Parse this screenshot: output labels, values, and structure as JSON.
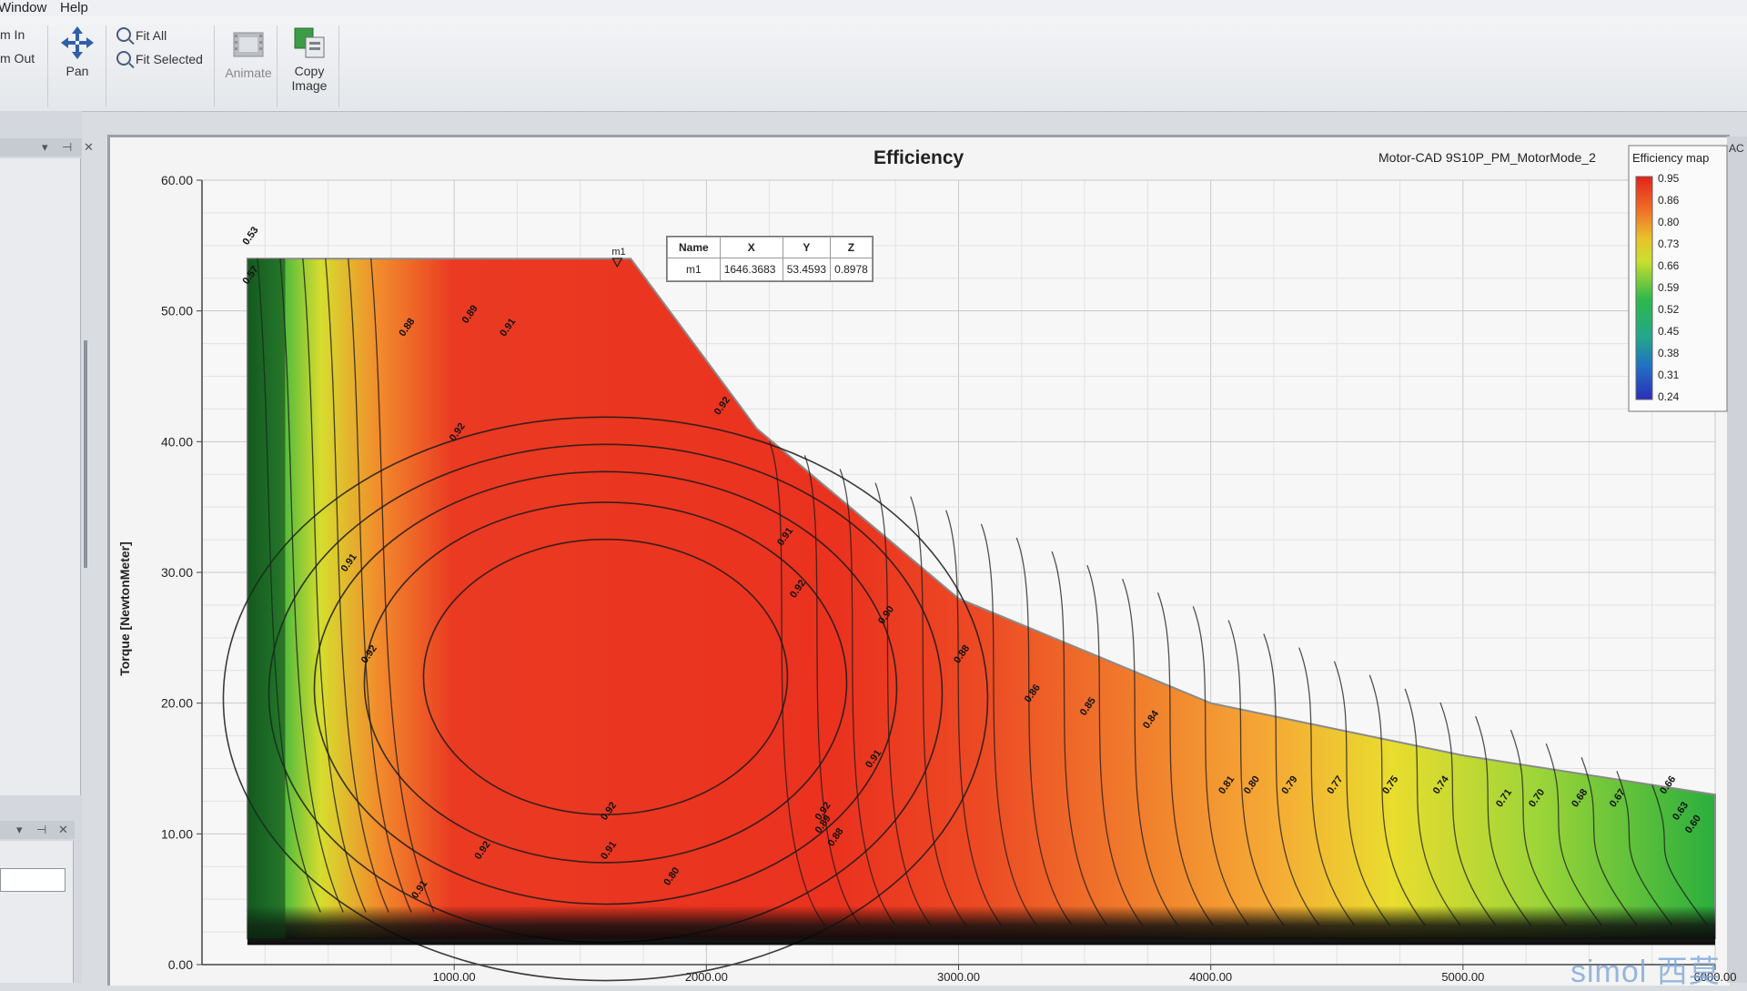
{
  "menu": {
    "window": "Window",
    "help": "Help"
  },
  "toolbar": {
    "zoom_in": "m In",
    "zoom_out": "m Out",
    "pan": "Pan",
    "fit_all": "Fit All",
    "fit_selected": "Fit Selected",
    "animate": "Animate",
    "copy_image": [
      "Copy",
      "Image"
    ]
  },
  "panel_controls": {
    "dropdown": "▾",
    "pin": "⊣",
    "close": "✕"
  },
  "right_tab": "AC",
  "chart": {
    "title": "Efficiency",
    "subtitle": "Motor-CAD 9S10P_PM_MotorMode_2",
    "ylabel": "Torque [NewtonMeter]",
    "watermark": "simol 西莫"
  },
  "marker_table": {
    "headers": [
      "Name",
      "X",
      "Y",
      "Z"
    ],
    "rows": [
      [
        "m1",
        "1646.3683",
        "53.4593",
        "0.8978"
      ]
    ]
  },
  "colors": {
    "red": "#e8321e",
    "orange": "#f0802a",
    "yellow": "#e6e02c",
    "green": "#2fb84a",
    "blue": "#2a3fc8"
  },
  "chart_data": {
    "type": "heatmap",
    "title": "Efficiency",
    "subtitle": "Motor-CAD 9S10P_PM_MotorMode_2",
    "xlabel": "",
    "ylabel": "Torque [NewtonMeter]",
    "xlim": [
      0,
      6000
    ],
    "ylim": [
      0,
      60
    ],
    "x_ticks": [
      "1000.00",
      "2000.00",
      "3000.00",
      "4000.00",
      "5000.00",
      "6000.00"
    ],
    "y_ticks": [
      "0.00",
      "10.00",
      "20.00",
      "30.00",
      "40.00",
      "50.00",
      "60.00"
    ],
    "legend": {
      "title": "Efficiency map",
      "position": "top-right",
      "labels": [
        "0.95",
        "0.86",
        "0.80",
        "0.73",
        "0.66",
        "0.59",
        "0.52",
        "0.45",
        "0.38",
        "0.31",
        "0.24"
      ]
    },
    "envelope": {
      "x": [
        180,
        1700,
        2200,
        3000,
        4000,
        5000,
        6000
      ],
      "y": [
        54,
        54,
        41,
        28,
        20,
        16,
        13
      ]
    },
    "contour_labels": [
      {
        "text": "0.53",
        "x": 180,
        "y": 55
      },
      {
        "text": "0.57",
        "x": 180,
        "y": 52
      },
      {
        "text": "0.88",
        "x": 800,
        "y": 48
      },
      {
        "text": "0.89",
        "x": 1050,
        "y": 49
      },
      {
        "text": "0.91",
        "x": 1200,
        "y": 48
      },
      {
        "text": "0.92",
        "x": 1000,
        "y": 40
      },
      {
        "text": "0.92",
        "x": 2050,
        "y": 42
      },
      {
        "text": "0.91",
        "x": 2300,
        "y": 32
      },
      {
        "text": "0.92",
        "x": 2350,
        "y": 28
      },
      {
        "text": "0.90",
        "x": 2700,
        "y": 26
      },
      {
        "text": "0.88",
        "x": 3000,
        "y": 23
      },
      {
        "text": "0.86",
        "x": 3280,
        "y": 20
      },
      {
        "text": "0.85",
        "x": 3500,
        "y": 19
      },
      {
        "text": "0.84",
        "x": 3750,
        "y": 18
      },
      {
        "text": "0.91",
        "x": 2650,
        "y": 15
      },
      {
        "text": "0.92",
        "x": 2450,
        "y": 11
      },
      {
        "text": "0.89",
        "x": 2450,
        "y": 10
      },
      {
        "text": "0.88",
        "x": 2500,
        "y": 9
      },
      {
        "text": "0.92",
        "x": 1600,
        "y": 11
      },
      {
        "text": "0.92",
        "x": 1100,
        "y": 8
      },
      {
        "text": "0.91",
        "x": 1600,
        "y": 8
      },
      {
        "text": "0.80",
        "x": 1850,
        "y": 6
      },
      {
        "text": "0.91",
        "x": 850,
        "y": 5
      },
      {
        "text": "0.91",
        "x": 570,
        "y": 30
      },
      {
        "text": "0.92",
        "x": 650,
        "y": 23
      },
      {
        "text": "0.81",
        "x": 4050,
        "y": 13
      },
      {
        "text": "0.80",
        "x": 4150,
        "y": 13
      },
      {
        "text": "0.79",
        "x": 4300,
        "y": 13
      },
      {
        "text": "0.77",
        "x": 4480,
        "y": 13
      },
      {
        "text": "0.75",
        "x": 4700,
        "y": 13
      },
      {
        "text": "0.74",
        "x": 4900,
        "y": 13
      },
      {
        "text": "0.71",
        "x": 5150,
        "y": 12
      },
      {
        "text": "0.70",
        "x": 5280,
        "y": 12
      },
      {
        "text": "0.68",
        "x": 5450,
        "y": 12
      },
      {
        "text": "0.67",
        "x": 5600,
        "y": 12
      },
      {
        "text": "0.66",
        "x": 5800,
        "y": 13
      },
      {
        "text": "0.63",
        "x": 5850,
        "y": 11
      },
      {
        "text": "0.60",
        "x": 5900,
        "y": 10
      }
    ],
    "marker": {
      "name": "m1",
      "x": 1646.3683,
      "y": 53.4593,
      "z": 0.8978
    }
  }
}
